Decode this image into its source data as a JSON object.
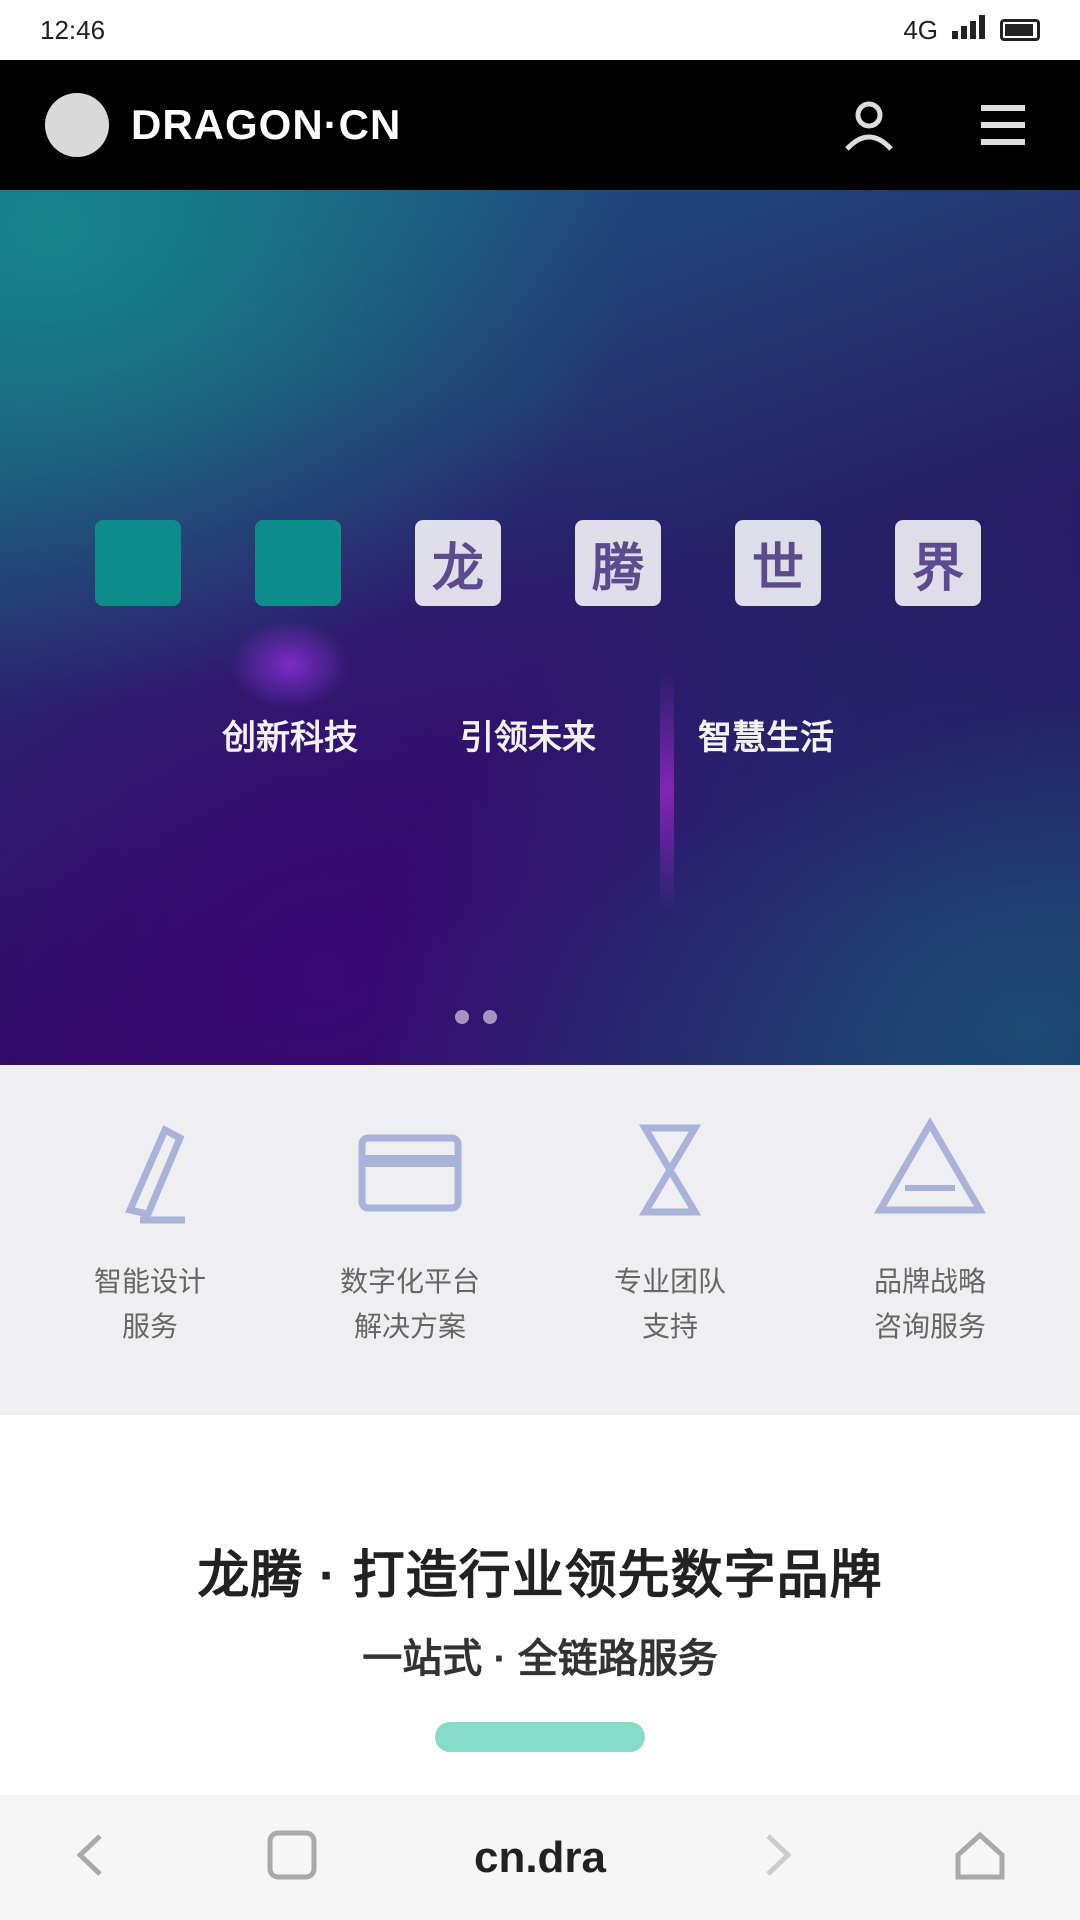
{
  "status_bar": {
    "time": "12:46",
    "carrier": "4G"
  },
  "app_bar": {
    "title": "DRAGON·CN"
  },
  "hero": {
    "tiles": [
      "",
      "",
      "龙",
      "腾",
      "世",
      "界"
    ],
    "tags": [
      "创新科技",
      "引领未来",
      "智慧生活"
    ]
  },
  "features": [
    {
      "icon": "pen-icon",
      "label_line1": "智能设计",
      "label_line2": "服务"
    },
    {
      "icon": "card-icon",
      "label_line1": "数字化平台",
      "label_line2": "解决方案"
    },
    {
      "icon": "person-icon",
      "label_line1": "专业团队",
      "label_line2": "支持"
    },
    {
      "icon": "triangle-icon",
      "label_line1": "品牌战略",
      "label_line2": "咨询服务"
    }
  ],
  "promo": {
    "title": "龙腾 · 打造行业领先数字品牌",
    "subtitle": "一站式 · 全链路服务"
  },
  "browser_bar": {
    "url": "cn.dra"
  },
  "colors": {
    "app_bar": "#000000",
    "accent_teal": "#0e8c8a",
    "promo_button": "#86dcc8"
  }
}
